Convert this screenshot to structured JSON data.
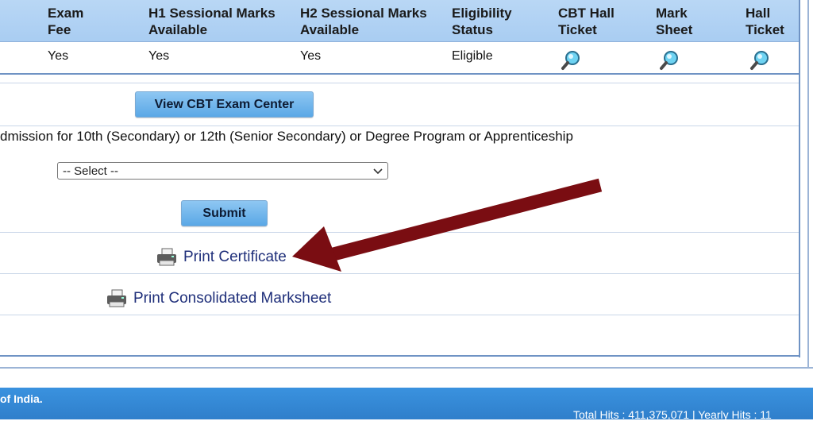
{
  "table": {
    "headers": {
      "exam_fee": "Exam\nFee",
      "h1": "H1 Sessional Marks\nAvailable",
      "h2": "H2 Sessional Marks\nAvailable",
      "eligibility": "Eligibility\nStatus",
      "cbt": "CBT Hall\nTicket",
      "mark_sheet": "Mark\nSheet",
      "hall_ticket": "Hall\nTicket"
    },
    "row": {
      "exam_fee": "Yes",
      "h1": "Yes",
      "h2": "Yes",
      "eligibility": "Eligible"
    }
  },
  "cbt_button": "View CBT Exam Center",
  "admission_text": "dmission for 10th (Secondary) or 12th (Senior Secondary) or Degree Program or Apprenticeship",
  "select": {
    "selected": "-- Select --"
  },
  "submit_button": "Submit",
  "print_certificate": "Print Certificate",
  "print_marksheet": "Print Consolidated Marksheet",
  "footer": {
    "org": "of India.",
    "hits": "Total Hits : 411,375,071 | Yearly Hits : 11"
  },
  "colors": {
    "header_bg": "#b9d7f5",
    "button": "#6fb5ec",
    "footer": "#3a8ad8",
    "arrow": "#7a0d12",
    "link": "#1f2f7a"
  }
}
